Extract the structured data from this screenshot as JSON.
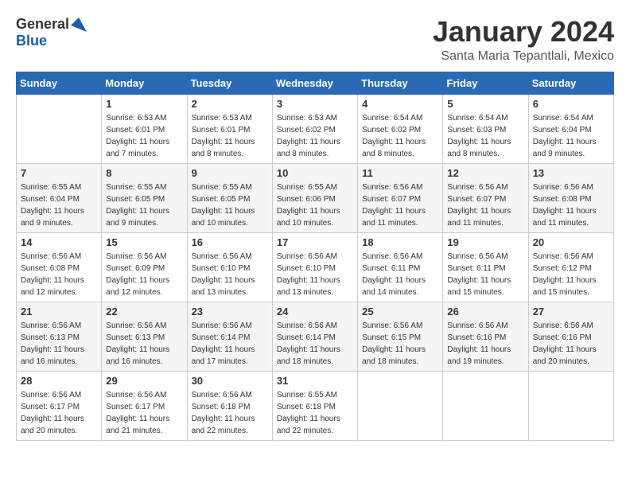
{
  "header": {
    "logo": {
      "general": "General",
      "blue": "Blue"
    },
    "title": "January 2024",
    "location": "Santa Maria Tepantlali, Mexico"
  },
  "calendar": {
    "days_of_week": [
      "Sunday",
      "Monday",
      "Tuesday",
      "Wednesday",
      "Thursday",
      "Friday",
      "Saturday"
    ],
    "weeks": [
      [
        {
          "day": "",
          "sunrise": "",
          "sunset": "",
          "daylight": ""
        },
        {
          "day": "1",
          "sunrise": "Sunrise: 6:53 AM",
          "sunset": "Sunset: 6:01 PM",
          "daylight": "Daylight: 11 hours and 7 minutes."
        },
        {
          "day": "2",
          "sunrise": "Sunrise: 6:53 AM",
          "sunset": "Sunset: 6:01 PM",
          "daylight": "Daylight: 11 hours and 8 minutes."
        },
        {
          "day": "3",
          "sunrise": "Sunrise: 6:53 AM",
          "sunset": "Sunset: 6:02 PM",
          "daylight": "Daylight: 11 hours and 8 minutes."
        },
        {
          "day": "4",
          "sunrise": "Sunrise: 6:54 AM",
          "sunset": "Sunset: 6:02 PM",
          "daylight": "Daylight: 11 hours and 8 minutes."
        },
        {
          "day": "5",
          "sunrise": "Sunrise: 6:54 AM",
          "sunset": "Sunset: 6:03 PM",
          "daylight": "Daylight: 11 hours and 8 minutes."
        },
        {
          "day": "6",
          "sunrise": "Sunrise: 6:54 AM",
          "sunset": "Sunset: 6:04 PM",
          "daylight": "Daylight: 11 hours and 9 minutes."
        }
      ],
      [
        {
          "day": "7",
          "sunrise": "Sunrise: 6:55 AM",
          "sunset": "Sunset: 6:04 PM",
          "daylight": "Daylight: 11 hours and 9 minutes."
        },
        {
          "day": "8",
          "sunrise": "Sunrise: 6:55 AM",
          "sunset": "Sunset: 6:05 PM",
          "daylight": "Daylight: 11 hours and 9 minutes."
        },
        {
          "day": "9",
          "sunrise": "Sunrise: 6:55 AM",
          "sunset": "Sunset: 6:05 PM",
          "daylight": "Daylight: 11 hours and 10 minutes."
        },
        {
          "day": "10",
          "sunrise": "Sunrise: 6:55 AM",
          "sunset": "Sunset: 6:06 PM",
          "daylight": "Daylight: 11 hours and 10 minutes."
        },
        {
          "day": "11",
          "sunrise": "Sunrise: 6:56 AM",
          "sunset": "Sunset: 6:07 PM",
          "daylight": "Daylight: 11 hours and 11 minutes."
        },
        {
          "day": "12",
          "sunrise": "Sunrise: 6:56 AM",
          "sunset": "Sunset: 6:07 PM",
          "daylight": "Daylight: 11 hours and 11 minutes."
        },
        {
          "day": "13",
          "sunrise": "Sunrise: 6:56 AM",
          "sunset": "Sunset: 6:08 PM",
          "daylight": "Daylight: 11 hours and 11 minutes."
        }
      ],
      [
        {
          "day": "14",
          "sunrise": "Sunrise: 6:56 AM",
          "sunset": "Sunset: 6:08 PM",
          "daylight": "Daylight: 11 hours and 12 minutes."
        },
        {
          "day": "15",
          "sunrise": "Sunrise: 6:56 AM",
          "sunset": "Sunset: 6:09 PM",
          "daylight": "Daylight: 11 hours and 12 minutes."
        },
        {
          "day": "16",
          "sunrise": "Sunrise: 6:56 AM",
          "sunset": "Sunset: 6:10 PM",
          "daylight": "Daylight: 11 hours and 13 minutes."
        },
        {
          "day": "17",
          "sunrise": "Sunrise: 6:56 AM",
          "sunset": "Sunset: 6:10 PM",
          "daylight": "Daylight: 11 hours and 13 minutes."
        },
        {
          "day": "18",
          "sunrise": "Sunrise: 6:56 AM",
          "sunset": "Sunset: 6:11 PM",
          "daylight": "Daylight: 11 hours and 14 minutes."
        },
        {
          "day": "19",
          "sunrise": "Sunrise: 6:56 AM",
          "sunset": "Sunset: 6:11 PM",
          "daylight": "Daylight: 11 hours and 15 minutes."
        },
        {
          "day": "20",
          "sunrise": "Sunrise: 6:56 AM",
          "sunset": "Sunset: 6:12 PM",
          "daylight": "Daylight: 11 hours and 15 minutes."
        }
      ],
      [
        {
          "day": "21",
          "sunrise": "Sunrise: 6:56 AM",
          "sunset": "Sunset: 6:13 PM",
          "daylight": "Daylight: 11 hours and 16 minutes."
        },
        {
          "day": "22",
          "sunrise": "Sunrise: 6:56 AM",
          "sunset": "Sunset: 6:13 PM",
          "daylight": "Daylight: 11 hours and 16 minutes."
        },
        {
          "day": "23",
          "sunrise": "Sunrise: 6:56 AM",
          "sunset": "Sunset: 6:14 PM",
          "daylight": "Daylight: 11 hours and 17 minutes."
        },
        {
          "day": "24",
          "sunrise": "Sunrise: 6:56 AM",
          "sunset": "Sunset: 6:14 PM",
          "daylight": "Daylight: 11 hours and 18 minutes."
        },
        {
          "day": "25",
          "sunrise": "Sunrise: 6:56 AM",
          "sunset": "Sunset: 6:15 PM",
          "daylight": "Daylight: 11 hours and 18 minutes."
        },
        {
          "day": "26",
          "sunrise": "Sunrise: 6:56 AM",
          "sunset": "Sunset: 6:16 PM",
          "daylight": "Daylight: 11 hours and 19 minutes."
        },
        {
          "day": "27",
          "sunrise": "Sunrise: 6:56 AM",
          "sunset": "Sunset: 6:16 PM",
          "daylight": "Daylight: 11 hours and 20 minutes."
        }
      ],
      [
        {
          "day": "28",
          "sunrise": "Sunrise: 6:56 AM",
          "sunset": "Sunset: 6:17 PM",
          "daylight": "Daylight: 11 hours and 20 minutes."
        },
        {
          "day": "29",
          "sunrise": "Sunrise: 6:56 AM",
          "sunset": "Sunset: 6:17 PM",
          "daylight": "Daylight: 11 hours and 21 minutes."
        },
        {
          "day": "30",
          "sunrise": "Sunrise: 6:56 AM",
          "sunset": "Sunset: 6:18 PM",
          "daylight": "Daylight: 11 hours and 22 minutes."
        },
        {
          "day": "31",
          "sunrise": "Sunrise: 6:55 AM",
          "sunset": "Sunset: 6:18 PM",
          "daylight": "Daylight: 11 hours and 22 minutes."
        },
        {
          "day": "",
          "sunrise": "",
          "sunset": "",
          "daylight": ""
        },
        {
          "day": "",
          "sunrise": "",
          "sunset": "",
          "daylight": ""
        },
        {
          "day": "",
          "sunrise": "",
          "sunset": "",
          "daylight": ""
        }
      ]
    ]
  }
}
